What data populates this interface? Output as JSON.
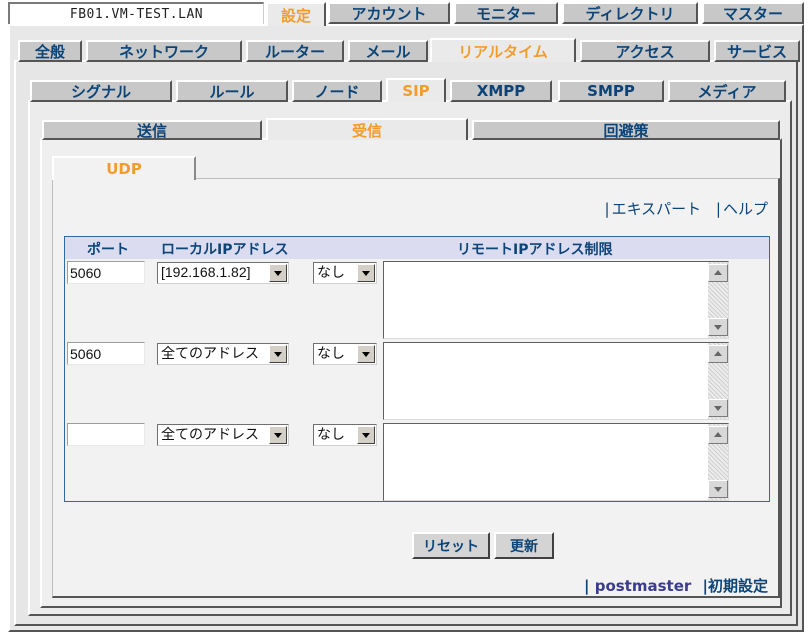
{
  "host": "FB01.VM-TEST.LAN",
  "main_tabs": [
    "設定",
    "アカウント",
    "モニター",
    "ディレクトリ",
    "マスター"
  ],
  "settings_tabs": [
    "全般",
    "ネットワーク",
    "ルーター",
    "メール",
    "リアルタイム",
    "アクセス",
    "サービス"
  ],
  "realtime_tabs": [
    "シグナル",
    "ルール",
    "ノード",
    "SIP",
    "XMPP",
    "SMPP",
    "メディア"
  ],
  "sip_tabs": [
    "送信",
    "受信",
    "回避策"
  ],
  "transport_tab": "UDP",
  "links": {
    "bar": "|",
    "expert": "エキスパート",
    "help": "ヘルプ"
  },
  "table": {
    "headers": {
      "port": "ポート",
      "local_ip": "ローカルIPアドレス",
      "remote_ip": "リモートIPアドレス制限"
    },
    "rows": [
      {
        "port": "5060",
        "local_ip": "[192.168.1.82]",
        "restriction": "なし",
        "remote": ""
      },
      {
        "port": "5060",
        "local_ip": "全てのアドレス",
        "restriction": "なし",
        "remote": ""
      },
      {
        "port": "",
        "local_ip": "全てのアドレス",
        "restriction": "なし",
        "remote": ""
      }
    ]
  },
  "buttons": {
    "reset": "リセット",
    "update": "更新"
  },
  "footer": {
    "user": "postmaster",
    "initial": "初期設定"
  },
  "colors": {
    "active_tab": "#f39c2e",
    "text": "#0c4478",
    "tab_bg": "#c8c8c8"
  }
}
